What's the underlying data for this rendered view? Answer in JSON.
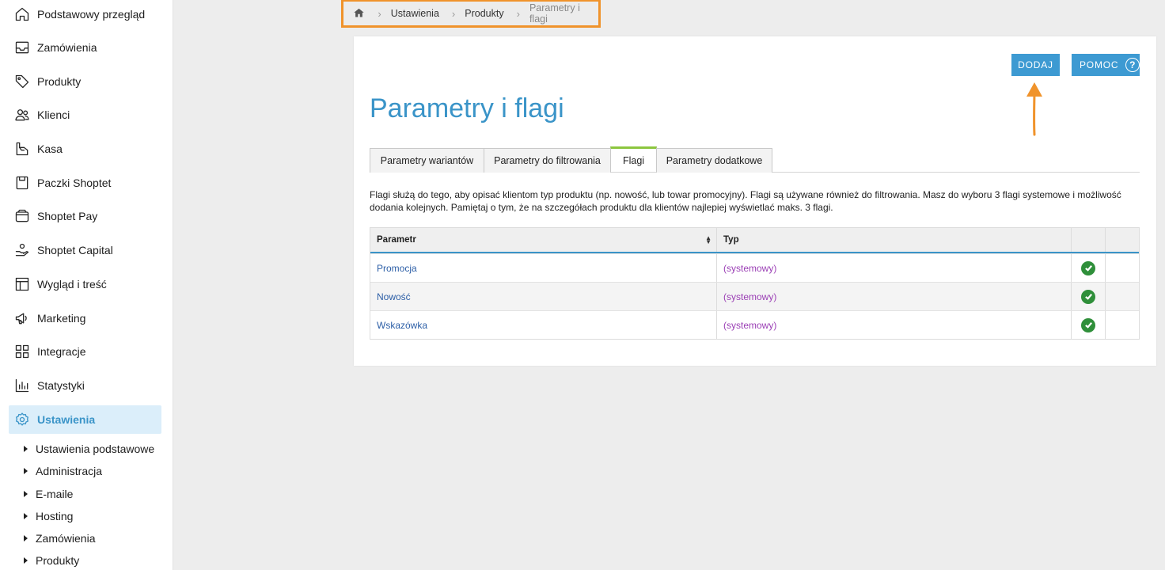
{
  "sidebar": {
    "items": [
      {
        "label": "Podstawowy przegląd",
        "icon": "home-icon"
      },
      {
        "label": "Zamówienia",
        "icon": "inbox-icon"
      },
      {
        "label": "Produkty",
        "icon": "tag-icon"
      },
      {
        "label": "Klienci",
        "icon": "users-icon"
      },
      {
        "label": "Kasa",
        "icon": "cash-register-icon"
      },
      {
        "label": "Paczki Shoptet",
        "icon": "package-icon"
      },
      {
        "label": "Shoptet Pay",
        "icon": "wallet-icon"
      },
      {
        "label": "Shoptet Capital",
        "icon": "capital-icon"
      },
      {
        "label": "Wygląd i treść",
        "icon": "layout-icon"
      },
      {
        "label": "Marketing",
        "icon": "megaphone-icon"
      },
      {
        "label": "Integracje",
        "icon": "grid-icon"
      },
      {
        "label": "Statystyki",
        "icon": "chart-icon"
      },
      {
        "label": "Ustawienia",
        "icon": "gear-icon",
        "active": true
      }
    ],
    "subitems": [
      {
        "label": "Ustawienia podstawowe"
      },
      {
        "label": "Administracja"
      },
      {
        "label": "E-maile"
      },
      {
        "label": "Hosting"
      },
      {
        "label": "Zamówienia"
      },
      {
        "label": "Produkty"
      }
    ]
  },
  "breadcrumb": {
    "items": [
      "Ustawienia",
      "Produkty"
    ],
    "current": "Parametry i flagi"
  },
  "toolbar": {
    "add_label": "DODAJ",
    "help_label": "POMOC",
    "help_icon_glyph": "?"
  },
  "page": {
    "title": "Parametry i flagi",
    "description": "Flagi służą do tego, aby opisać klientom typ produktu (np. nowość, lub towar promocyjny). Flagi są używane również do filtrowania. Masz do wyboru 3 flagi systemowe i możliwość dodania kolejnych. Pamiętaj o tym, że na szczegółach produktu dla klientów najlepiej wyświetlać maks. 3 flagi."
  },
  "tabs": [
    {
      "label": "Parametry wariantów"
    },
    {
      "label": "Parametry do filtrowania"
    },
    {
      "label": "Flagi",
      "active": true
    },
    {
      "label": "Parametry dodatkowe"
    }
  ],
  "table": {
    "headers": {
      "param": "Parametr",
      "type": "Typ"
    },
    "rows": [
      {
        "name": "Promocja",
        "type": "(systemowy)",
        "active": true
      },
      {
        "name": "Nowość",
        "type": "(systemowy)",
        "active": true
      },
      {
        "name": "Wskazówka",
        "type": "(systemowy)",
        "active": true
      }
    ]
  },
  "colors": {
    "accent": "#3a94c8",
    "button": "#3d9ad2",
    "annotation": "#f0932b",
    "tab_active": "#8cc63f",
    "type_text": "#9b3fb5",
    "check": "#2f8f3a"
  }
}
